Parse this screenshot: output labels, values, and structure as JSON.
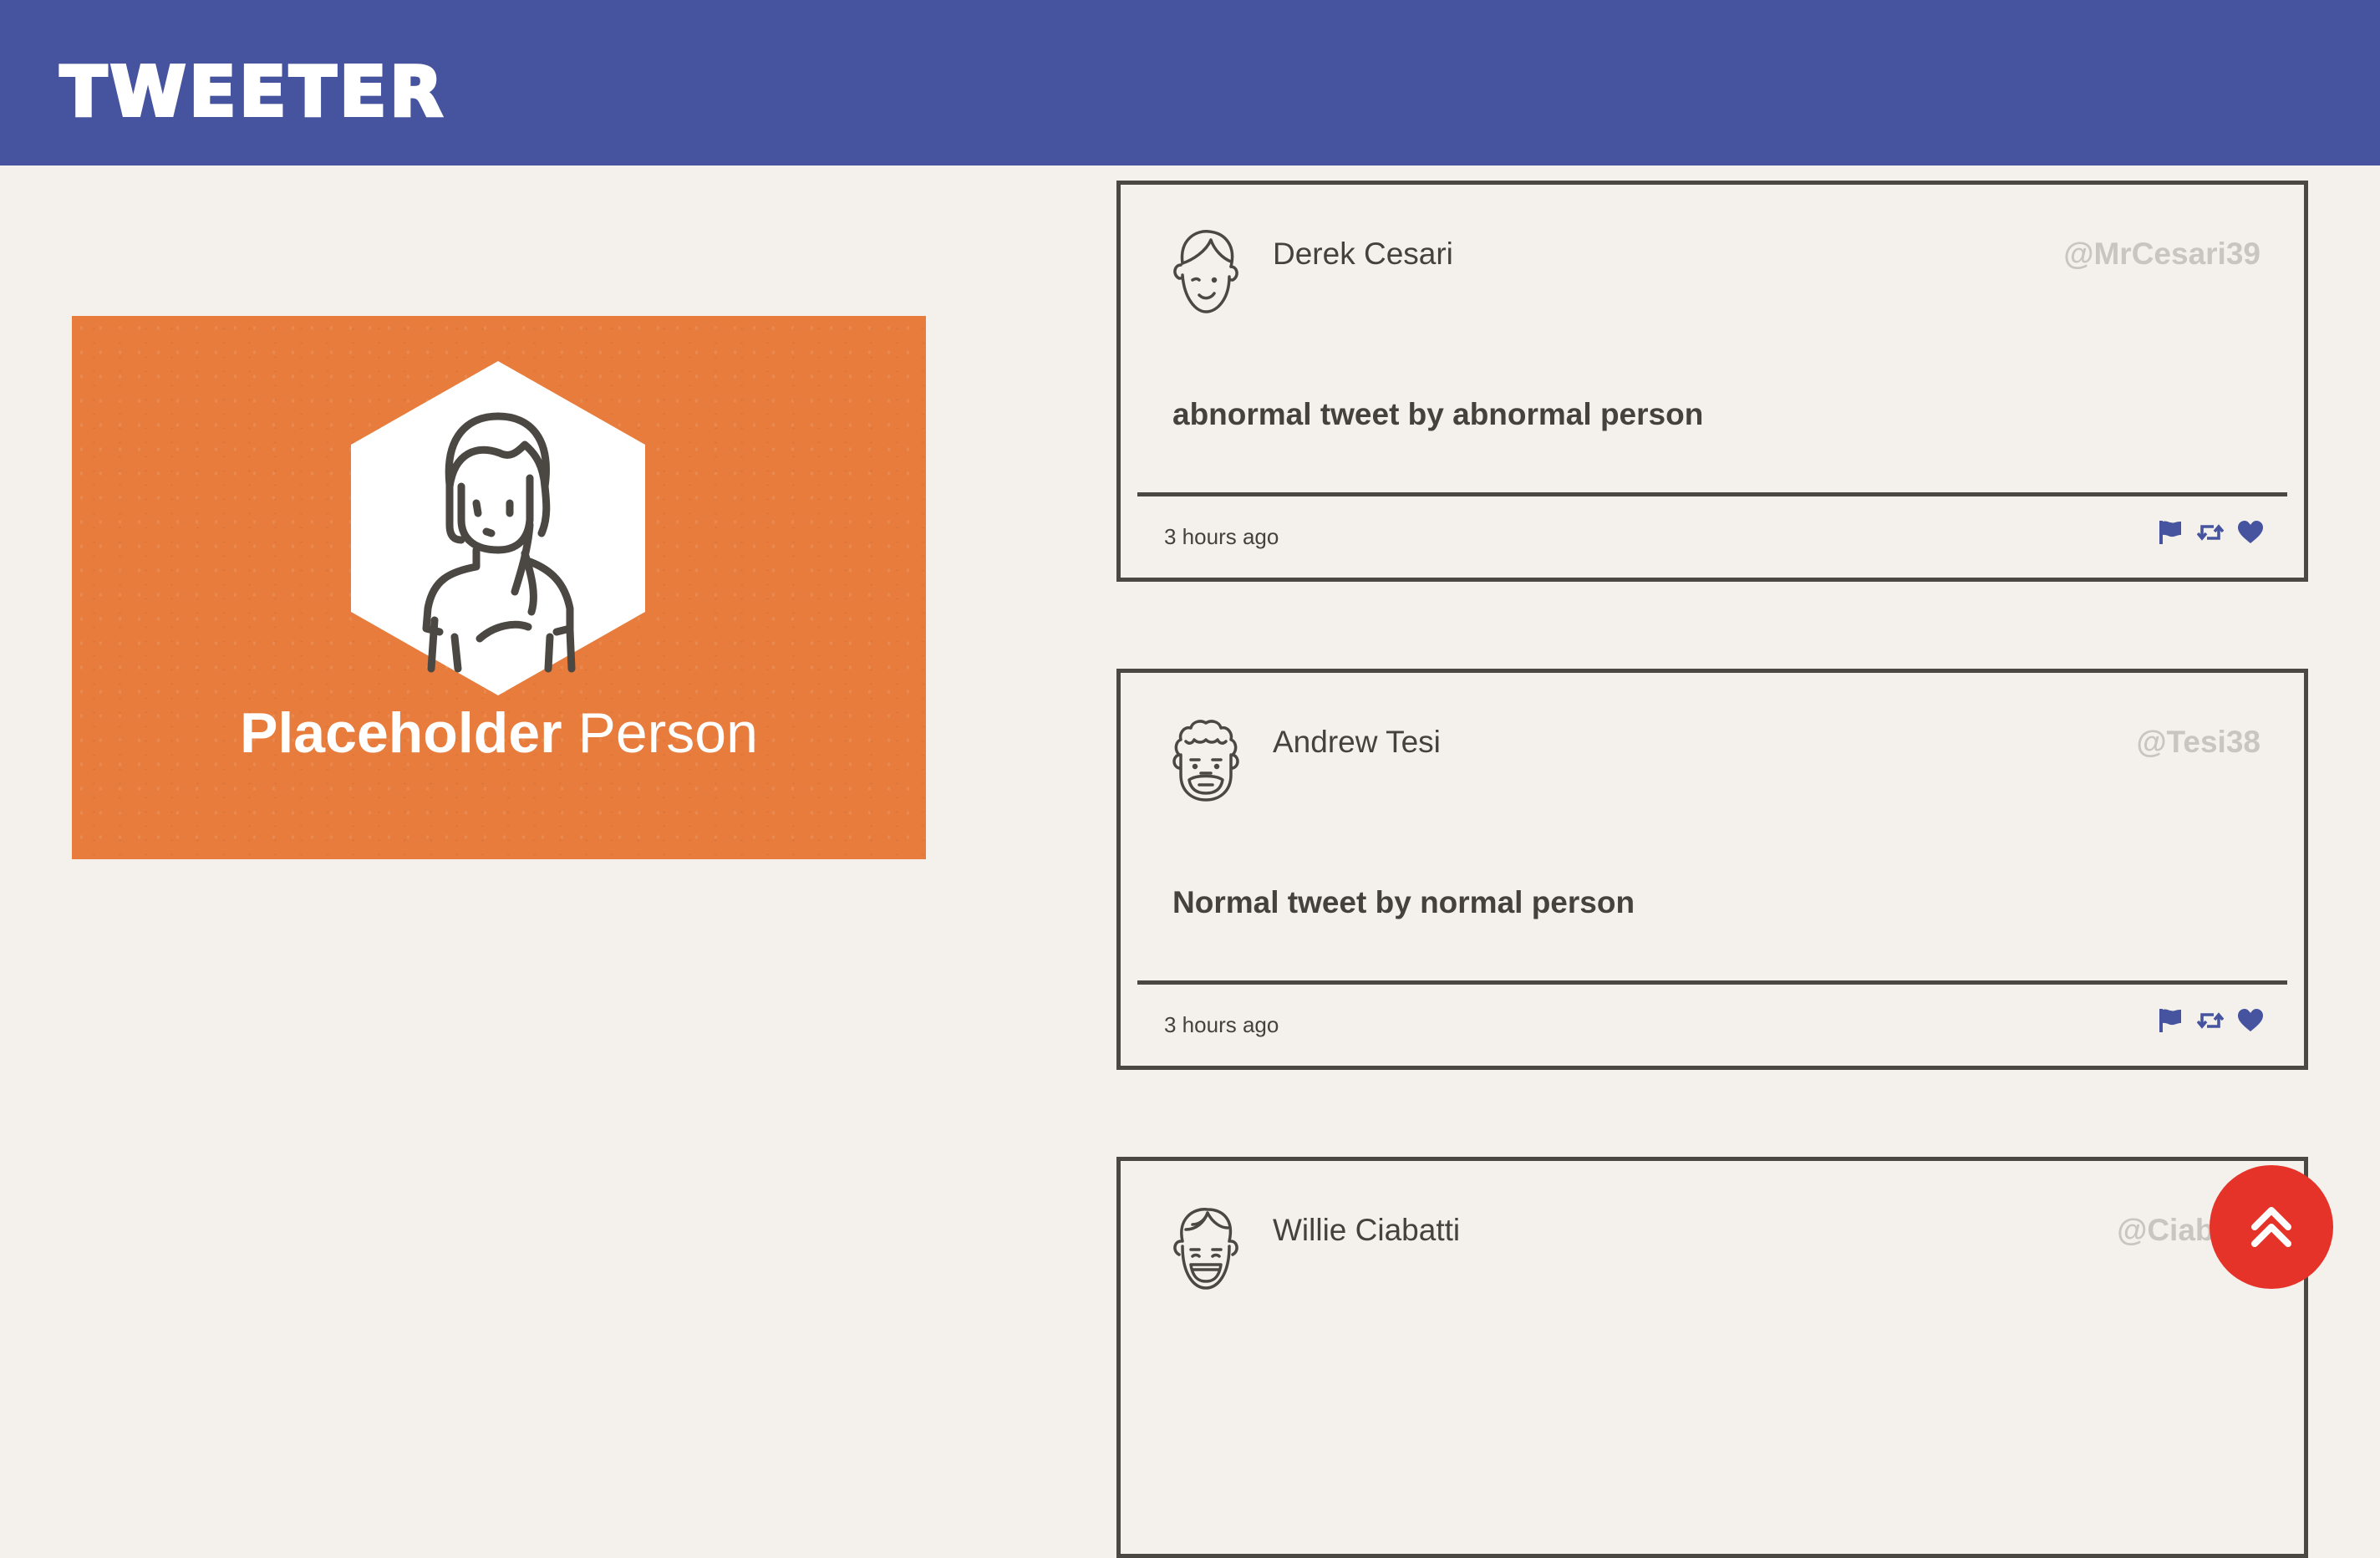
{
  "header": {
    "logo": "TWEETER",
    "bg_color": "#4654a0"
  },
  "profile": {
    "first_name": "Placeholder",
    "last_name": "Person",
    "card_color": "#e77c3c",
    "avatar_icon": "woman-avatar-icon"
  },
  "tweets": [
    {
      "name": "Derek Cesari",
      "handle": "@MrCesari39",
      "text": "abnormal tweet by abnormal person",
      "time": "3 hours ago",
      "avatar_icon": "winking-man-avatar-icon"
    },
    {
      "name": "Andrew Tesi",
      "handle": "@Tesi38",
      "text": "Normal tweet by normal person",
      "time": "3 hours ago",
      "avatar_icon": "curly-hair-man-avatar-icon"
    },
    {
      "name": "Willie Ciabatti",
      "handle": "@Ciabatti",
      "text": "",
      "time": "",
      "avatar_icon": "laughing-man-avatar-icon"
    }
  ],
  "actions": {
    "flag_icon": "flag-icon",
    "retweet_icon": "retweet-icon",
    "like_icon": "heart-icon",
    "color": "#4654a0"
  },
  "fab": {
    "icon": "double-chevron-up-icon",
    "color": "#e63329"
  }
}
